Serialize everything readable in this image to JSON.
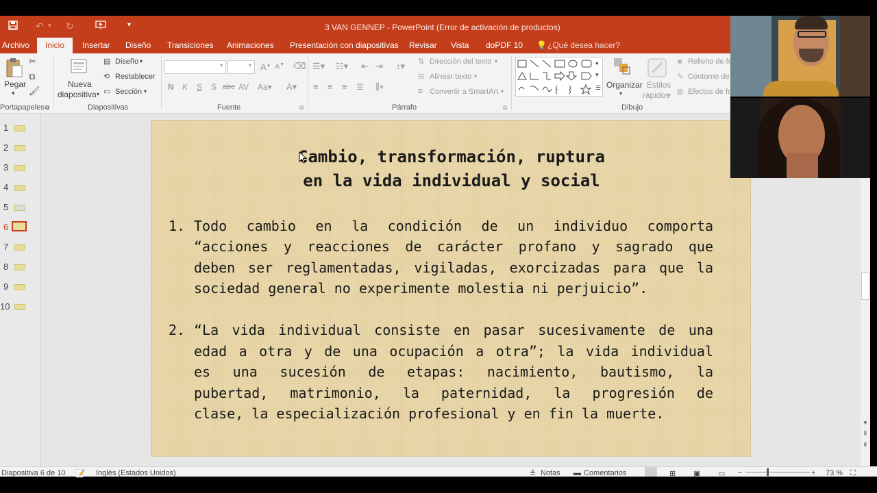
{
  "window": {
    "title": "3 VAN GENNEP - PowerPoint (Error de activación de productos)"
  },
  "tabs": [
    "Archivo",
    "Inicio",
    "Insertar",
    "Diseño",
    "Transiciones",
    "Animaciones",
    "Presentación con diapositivas",
    "Revisar",
    "Vista",
    "doPDF 10"
  ],
  "tell_me": "¿Qué desea hacer?",
  "ribbon": {
    "portapapeles": {
      "paste": "Pegar",
      "group": "Portapapeles"
    },
    "diapositivas": {
      "new_slide_1": "Nueva",
      "new_slide_2": "diapositiva",
      "layout": "Diseño",
      "reset": "Restablecer",
      "section": "Sección",
      "group": "Diapositivas"
    },
    "fuente": {
      "group": "Fuente",
      "bold": "N",
      "italic": "K",
      "underline": "S",
      "shadow": "S",
      "strike": "abc"
    },
    "parrafo": {
      "text_direction": "Dirección del texto",
      "align_text": "Alinear texto",
      "smartart": "Convertir a SmartArt",
      "group": "Párrafo"
    },
    "dibujo": {
      "arrange": "Organizar",
      "styles_1": "Estilos",
      "styles_2": "rápidos",
      "fill": "Relleno de fo",
      "outline": "Contorno de",
      "effects": "Efectos de fo",
      "group": "Dibujo"
    }
  },
  "thumbnails": [
    {
      "n": "1"
    },
    {
      "n": "2"
    },
    {
      "n": "3"
    },
    {
      "n": "4"
    },
    {
      "n": "5"
    },
    {
      "n": "6"
    },
    {
      "n": "7"
    },
    {
      "n": "8"
    },
    {
      "n": "9"
    },
    {
      "n": "10"
    }
  ],
  "active_slide_number": 6,
  "slide": {
    "title_line1": "Cambio, transformación, ruptura",
    "title_line2": "en la vida individual y social",
    "p1_num": "1.",
    "p1_lines": [
      "Todo cambio en la condición de un individuo comporta",
      "“acciones y reacciones de carácter profano y sagrado que",
      "deben ser reglamentadas, vigiladas, exorcizadas para que la",
      "sociedad general no experimente molestia ni perjuicio”."
    ],
    "p2_num": "2.",
    "p2_lines": [
      "“La vida individual consiste en pasar sucesivamente de una",
      "edad a otra y de una ocupación a otra”; la vida individual",
      "es una sucesión de etapas: nacimiento, bautismo, la",
      "pubertad, matrimonio, la paternidad, la progresión de",
      "clase, la especialización profesional y en fin la muerte."
    ]
  },
  "status": {
    "slide_info": "Diapositiva 6 de 10",
    "language": "Inglés (Estados Unidos)",
    "notes": "Notas",
    "comments": "Comentarios",
    "zoom": "73 %"
  }
}
